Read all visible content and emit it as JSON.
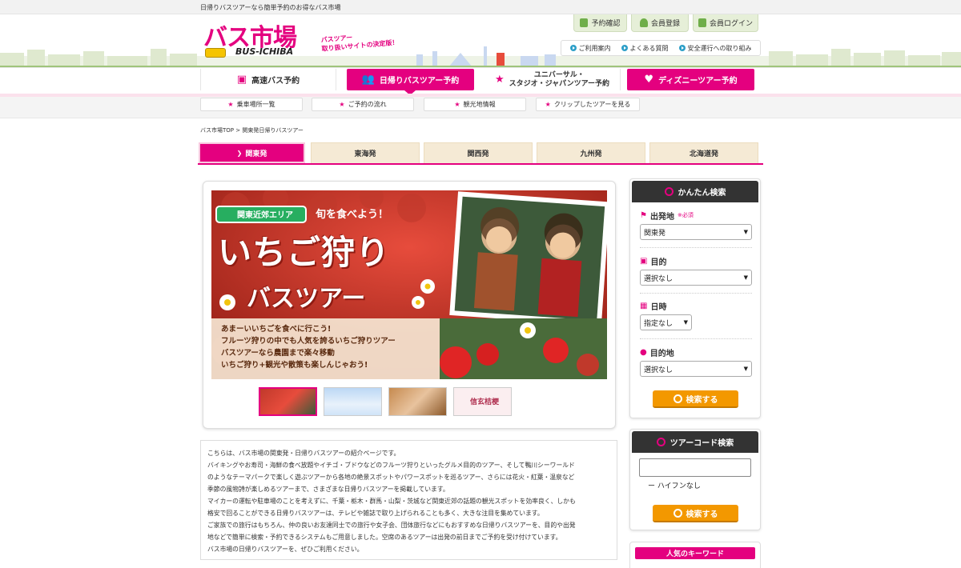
{
  "topbar": {
    "tagline": "日帰りバスツアーなら簡単予約のお得なバス市場"
  },
  "header": {
    "logo_main": "バス市場",
    "logo_sub": "BUS-ICHIBA",
    "catch_line1": "バスツアー",
    "catch_line2": "取り扱いサイトの決定版！",
    "buttons": {
      "reservation_check": "予約確認",
      "register": "会員登録",
      "login": "会員ログイン"
    },
    "subnav": {
      "guide": "ご利用案内",
      "faq": "よくある質問",
      "safety": "安全運行への取り組み"
    }
  },
  "mainnav": {
    "highway": "高速バス予約",
    "daytrip": "日帰りバスツアー予約",
    "usj_line1": "ユニバーサル・",
    "usj_line2": "スタジオ・ジャパンツアー予約",
    "disney": "ディズニーツアー予約"
  },
  "subnav2": {
    "stops": "乗車場所一覧",
    "flow": "ご予約の流れ",
    "sightseeing": "観光地情報",
    "clipped": "クリップしたツアーを見る"
  },
  "breadcrumb": "バス市場TOP > 関東発日帰りバスツアー",
  "regions": [
    "関東発",
    "東海発",
    "関西発",
    "九州発",
    "北海道発"
  ],
  "banner": {
    "area_tag": "関東近郊エリア",
    "seasonal": "旬を食べよう！",
    "title1": "いちご狩り",
    "title2": "バスツアー",
    "copy": [
      "あまーいいちごを食べに行こう!",
      "フルーツ狩りの中でも人気を誇るいちご狩りツアー",
      "バスツアーなら農園まで楽々移動",
      "いちご狩り+観光や散策も楽しんじゃおう!"
    ],
    "thumb4_text": "信玄桔梗"
  },
  "description": [
    "こちらは、バス市場の関東発・日帰りバスツアーの紹介ページです。",
    "バイキングやお寿司・海鮮の食べ放題やイチゴ・ブドウなどのフルーツ狩りといったグルメ目的のツアー、そして鴨川シーワールド",
    "のようなテーマパークで楽しく遊ぶツアーから各地の絶景スポットやパワースポットを巡るツアー、さらには花火・紅葉・温泉など",
    "季節の風物詩が楽しめるツアーまで、さまざまな日帰りバスツアーを掲載しています。",
    "マイカーの運転や駐車場のことを考えずに、千葉・栃木・群馬・山梨・茨城など関東近郊の話題の観光スポットを効率良く、しかも",
    "格安で回ることができる日帰りバスツアーは、テレビや雑誌で取り上げられることも多く、大きな注目を集めています。",
    "ご家族での旅行はもちろん、仲の良いお友達同士での旅行や女子会、団体旅行などにもおすすめな日帰りバスツアーを、目的や出発",
    "地などで簡単に検索・予約できるシステムもご用意しました。空席のあるツアーは出発の前日までご予約を受け付けています。",
    "バス市場の日帰りバスツアーを、ぜひご利用ください。"
  ],
  "search": {
    "title": "かんたん検索",
    "departure_label": "出発地",
    "required": "※必須",
    "departure_value": "関東発",
    "purpose_label": "目的",
    "purpose_value": "選択なし",
    "date_label": "日時",
    "date_value": "指定なし",
    "destination_label": "目的地",
    "destination_value": "選択なし",
    "button": "検索する"
  },
  "tourcode": {
    "title": "ツアーコード検索",
    "note": "ー ハイフンなし",
    "button": "検索する"
  },
  "keywords": {
    "title": "人気のキーワード"
  },
  "colors": {
    "brand_pink": "#e4007f",
    "search_orange": "#f39800",
    "region_tab": "#f5ead5"
  }
}
